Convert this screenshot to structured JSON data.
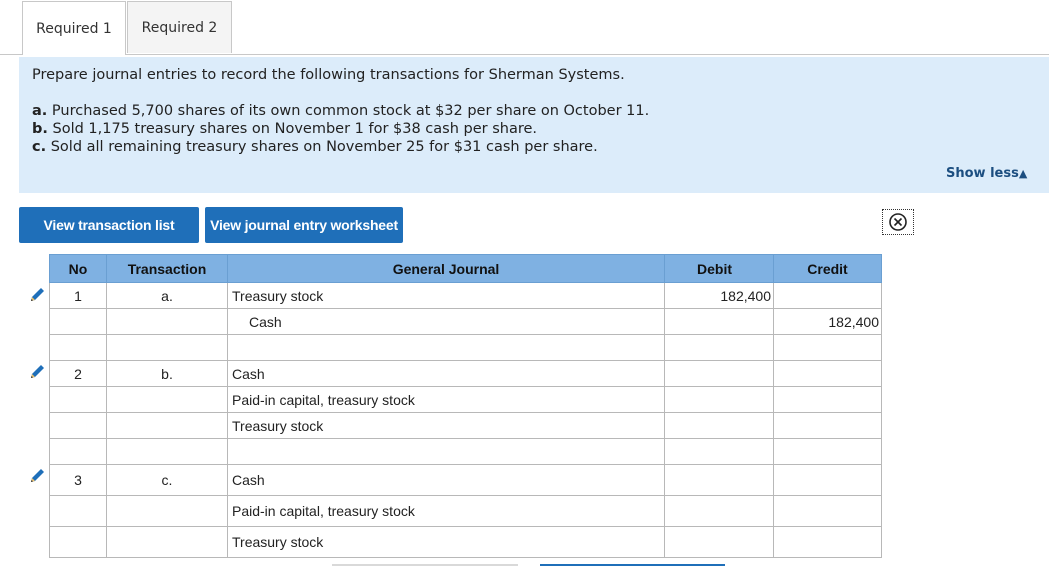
{
  "tabs": [
    {
      "label": "Required 1",
      "active": true
    },
    {
      "label": "Required 2",
      "active": false
    }
  ],
  "instructions": {
    "intro": "Prepare journal entries to record the following transactions for Sherman Systems.",
    "items": [
      {
        "letter": "a.",
        "text": " Purchased 5,700 shares of its own common stock at $32 per share on October 11."
      },
      {
        "letter": "b.",
        "text": " Sold 1,175 treasury shares on November 1 for $38 cash per share."
      },
      {
        "letter": "c.",
        "text": " Sold all remaining treasury shares on November 25 for $31 cash per share."
      }
    ]
  },
  "show_less": {
    "label": "Show less",
    "icon": "triangle-up-icon"
  },
  "buttons": {
    "view_transaction_list": "View transaction list",
    "view_journal_entry_worksheet": "View journal entry worksheet"
  },
  "close_icon": "circle-x-icon",
  "edit_icon": "pencil-icon",
  "colors": {
    "button_blue": "#1f6fb9",
    "header_blue": "#7fb1e2",
    "panel_blue": "#dcecfa"
  },
  "journal": {
    "headers": {
      "no": "No",
      "transaction": "Transaction",
      "general_journal": "General Journal",
      "debit": "Debit",
      "credit": "Credit"
    },
    "rows": [
      {
        "no": "1",
        "transaction": "a.",
        "account": "Treasury stock",
        "debit": "182,400",
        "credit": ""
      },
      {
        "no": "",
        "transaction": "",
        "account": "Cash",
        "debit": "",
        "credit": "182,400"
      },
      {
        "no": "",
        "transaction": "",
        "account": "",
        "debit": "",
        "credit": ""
      },
      {
        "no": "2",
        "transaction": "b.",
        "account": "Cash",
        "debit": "",
        "credit": ""
      },
      {
        "no": "",
        "transaction": "",
        "account": "Paid-in capital, treasury stock",
        "debit": "",
        "credit": ""
      },
      {
        "no": "",
        "transaction": "",
        "account": "Treasury stock",
        "debit": "",
        "credit": ""
      },
      {
        "no": "",
        "transaction": "",
        "account": "",
        "debit": "",
        "credit": ""
      },
      {
        "no": "3",
        "transaction": "c.",
        "account": "Cash",
        "debit": "",
        "credit": ""
      },
      {
        "no": "",
        "transaction": "",
        "account": "Paid-in capital, treasury stock",
        "debit": "",
        "credit": ""
      },
      {
        "no": "",
        "transaction": "",
        "account": "Treasury stock",
        "debit": "",
        "credit": ""
      }
    ]
  }
}
